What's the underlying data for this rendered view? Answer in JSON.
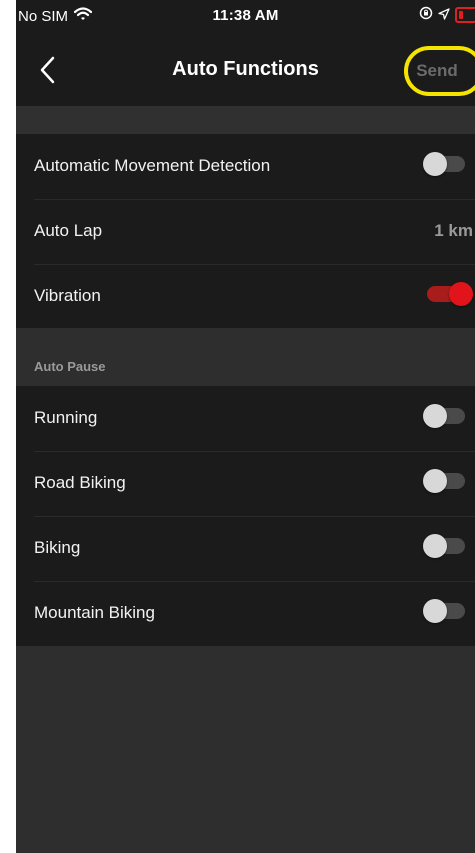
{
  "status_bar": {
    "carrier": "No SIM",
    "time": "11:38 AM"
  },
  "nav": {
    "title": "Auto Functions",
    "send_label": "Send"
  },
  "general_settings": [
    {
      "label": "Automatic Movement Detection",
      "type": "toggle",
      "on": false
    },
    {
      "label": "Auto Lap",
      "type": "value",
      "value": "1 km"
    },
    {
      "label": "Vibration",
      "type": "toggle",
      "on": true
    }
  ],
  "auto_pause": {
    "header": "Auto Pause",
    "items": [
      {
        "label": "Running",
        "on": false
      },
      {
        "label": "Road Biking",
        "on": false
      },
      {
        "label": "Biking",
        "on": false
      },
      {
        "label": "Mountain Biking",
        "on": false
      }
    ]
  },
  "colors": {
    "background": "#2e2e2f",
    "panel": "#1b1b1c",
    "toggle_on": "#e0141a",
    "highlight": "#f5e400"
  }
}
